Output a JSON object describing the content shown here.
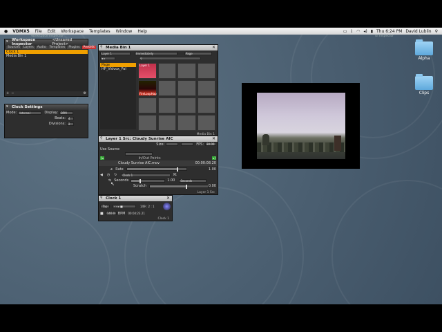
{
  "menubar": {
    "app_name": "VDMX5",
    "items": [
      "File",
      "Edit",
      "Workspace",
      "Templates",
      "Window",
      "Help"
    ],
    "clock": "Thu 6:24 PM",
    "user": "David Lublin"
  },
  "window_titles": {
    "workspace_bar": "Workspace Inspector",
    "ui_inspector": "UI Inspector"
  },
  "workspace_inspector": {
    "title": "Workspace Inspector",
    "project": "<Unsaved Project>",
    "tabs": [
      "Sources",
      "Layers",
      "Audio",
      "Templates",
      "Plugins",
      "Presets"
    ],
    "items": [
      "Clock 1",
      "Media Bin 1"
    ],
    "add_label": "+",
    "remove_label": "−"
  },
  "clock_settings": {
    "title": "Clock Settings",
    "mode_label": "Mode:",
    "mode_value": "Internal",
    "display_label": "Display:",
    "display_value": "BPM",
    "beats_label": "Beats:",
    "beats_value": "4",
    "divisions_label": "Divisions:",
    "divisions_value": "2"
  },
  "media_bin": {
    "title": "Media Bin 1",
    "layer_select": "Layer 1",
    "trigger_select": "Immediately",
    "page_select": "Page",
    "pages": [
      "Page",
      "HP_Vidvox_Pal"
    ],
    "cells": [
      "Layer 1",
      "FireLoopHap"
    ],
    "footer": "Media Bin 1"
  },
  "layer_source": {
    "title": "Layer 1 Src: Cloudy Sunrise AIC",
    "size_label": "Size:",
    "fps_label": "FPS:",
    "fps_value": "30.00",
    "use_source_label": "Use Source",
    "inout_label": "In/Out Points",
    "file_name": "Cloudy Sunrise AIC.mov",
    "timecode": "00:00:08.20",
    "rate_label": "Rate",
    "rate_value": "1.00",
    "clock_select": "Clock 1",
    "x_label": "Xt",
    "seconds_label": "Seconds",
    "seconds_value": "1.00",
    "seconds_select": "Seconds",
    "scratch_label": "Scratch",
    "scratch_value": "0.00",
    "footer": "Layer 1 Src"
  },
  "clock_panel": {
    "title": "Clock 1",
    "tap_label": "Tap",
    "bpm_value": "140.0",
    "bpm_label": "BPM",
    "measure": "149 : 2 : 1",
    "time": "00:04:23.21",
    "footer": "Clock 1"
  },
  "desktop": {
    "icons": [
      "Alpha",
      "Clips"
    ]
  }
}
